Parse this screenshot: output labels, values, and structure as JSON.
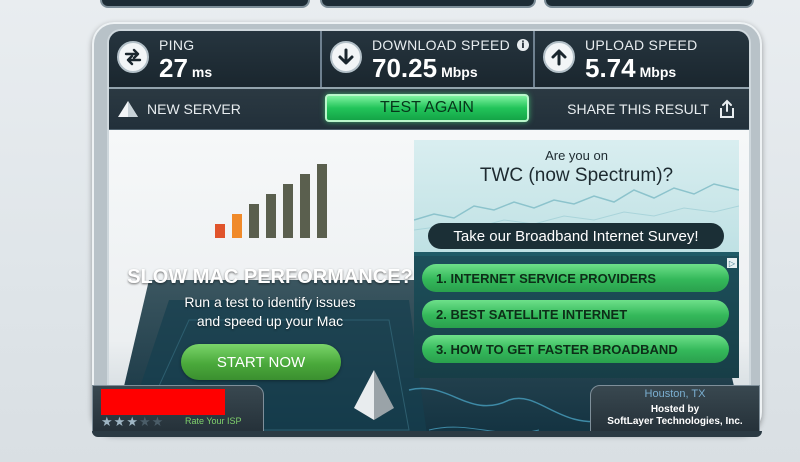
{
  "stats": {
    "ping": {
      "label": "PING",
      "value": "27",
      "unit": "ms",
      "icon": "ping-arrows-icon"
    },
    "download": {
      "label": "DOWNLOAD SPEED",
      "value": "70.25",
      "unit": "Mbps",
      "icon": "download-arrow-icon",
      "info": "i"
    },
    "upload": {
      "label": "UPLOAD SPEED",
      "value": "5.74",
      "unit": "Mbps",
      "icon": "upload-arrow-icon"
    }
  },
  "actions": {
    "new_server": "NEW SERVER",
    "test_again": "TEST AGAIN",
    "share": "SHARE THIS RESULT"
  },
  "ad_left": {
    "title": "SLOW MAC PERFORMANCE?",
    "line1": "Run a test to identify issues",
    "line2": "and speed up your Mac",
    "cta": "START NOW",
    "bar_colors": [
      "#e0542c",
      "#f08a2a",
      "#5a5f4e",
      "#5a5f4e",
      "#5a5f4e",
      "#5a5f4e",
      "#5a5f4e"
    ]
  },
  "survey": {
    "question_line1": "Are you on",
    "question_line2": "TWC (now Spectrum)?",
    "cta": "Take our Broadband Internet Survey!",
    "options": [
      "1.  INTERNET SERVICE PROVIDERS",
      "2.  BEST SATELLITE INTERNET",
      "3.  HOW TO GET FASTER BROADBAND"
    ]
  },
  "isp": {
    "rating": 3,
    "rating_max": 5,
    "rate_label": "Rate Your ISP"
  },
  "host": {
    "city": "Houston, TX",
    "hosted_by": "Hosted by",
    "company": "SoftLayer Technologies, Inc."
  },
  "colors": {
    "accent_green": "#22c45a",
    "panel_dark": "#1a262e",
    "redaction": "#ff0000"
  }
}
